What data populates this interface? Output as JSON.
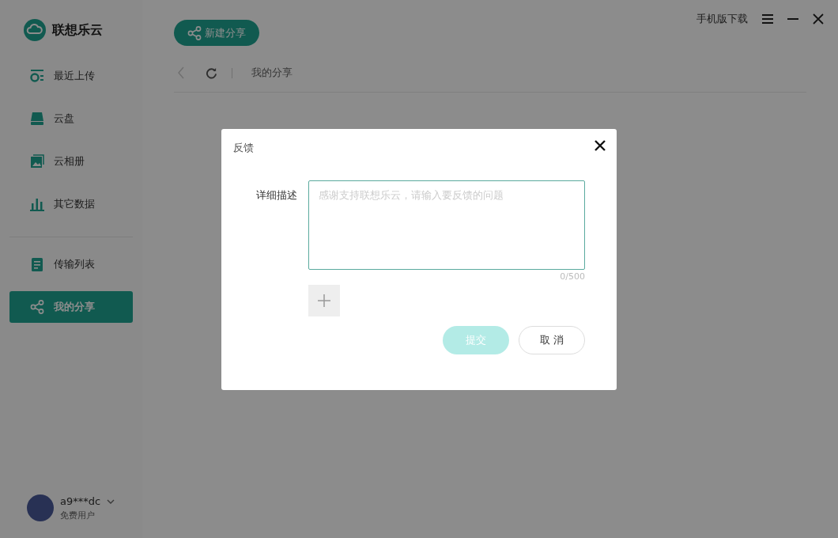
{
  "app": {
    "name": "联想乐云"
  },
  "new_share_button": "新建分享",
  "nav_groups": [
    [
      {
        "label": "最近上传",
        "kind": "recent",
        "selected": false
      },
      {
        "label": "云盘",
        "kind": "disk",
        "selected": false
      },
      {
        "label": "云相册",
        "kind": "album",
        "selected": false
      },
      {
        "label": "其它数据",
        "kind": "chart",
        "selected": false
      }
    ],
    [
      {
        "label": "传输列表",
        "kind": "list",
        "selected": false
      },
      {
        "label": "我的分享",
        "kind": "share",
        "selected": true
      }
    ]
  ],
  "top_bar": {
    "mobile_download": "手机版下载"
  },
  "breadcrumb": "我的分享",
  "user": {
    "name": "a9***dc",
    "plan": "免费用户"
  },
  "dialog": {
    "title": "反馈",
    "field_label": "详细描述",
    "placeholder": "感谢支持联想乐云，请输入要反馈的问题",
    "counter": "0/500",
    "submit": "提交",
    "submit_disabled": true,
    "cancel": "取 消"
  }
}
